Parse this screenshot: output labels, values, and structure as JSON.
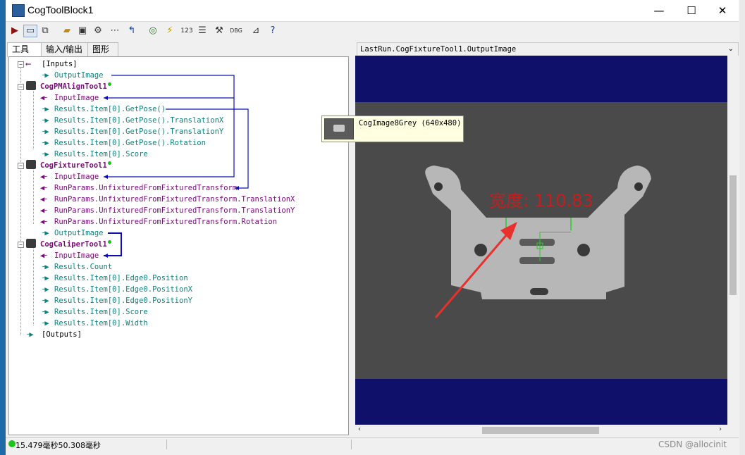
{
  "window": {
    "title": "CogToolBlock1",
    "minimize": "—",
    "maximize": "☐",
    "close": "✕"
  },
  "toolbar": {
    "items": [
      "run-icon",
      "display-icon",
      "view-icon",
      "open-icon",
      "save-icon",
      "settings-icon",
      "dots-icon",
      "reset-icon",
      "database-icon",
      "link-icon",
      "number-icon",
      "text-icon",
      "tools-icon",
      "debug-icon",
      "measure-icon",
      "help-icon"
    ]
  },
  "tabs": [
    "工具",
    "输入/输出",
    "图形"
  ],
  "tree": {
    "inputs_label": "[Inputs]",
    "inputs_output_image": "OutputImage",
    "pm_tool": "CogPMAlignTool1",
    "pm_input": "InputImage",
    "pm_pose": "Results.Item[0].GetPose()",
    "pm_tx": "Results.Item[0].GetPose().TranslationX",
    "pm_ty": "Results.Item[0].GetPose().TranslationY",
    "pm_rot": "Results.Item[0].GetPose().Rotation",
    "pm_score": "Results.Item[0].Score",
    "fix_tool": "CogFixtureTool1",
    "fix_input": "InputImage",
    "fix_transform": "RunParams.UnfixturedFromFixturedTransform",
    "fix_tx": "RunParams.UnfixturedFromFixturedTransform.TranslationX",
    "fix_ty": "RunParams.UnfixturedFromFixturedTransform.TranslationY",
    "fix_rot": "RunParams.UnfixturedFromFixturedTransform.Rotation",
    "fix_output": "OutputImage",
    "cal_tool": "CogCaliperTool1",
    "cal_input": "InputImage",
    "cal_count": "Results.Count",
    "cal_edge_pos": "Results.Item[0].Edge0.Position",
    "cal_edge_x": "Results.Item[0].Edge0.PositionX",
    "cal_edge_y": "Results.Item[0].Edge0.PositionY",
    "cal_score": "Results.Item[0].Score",
    "cal_width": "Results.Item[0].Width",
    "outputs_label": "[Outputs]"
  },
  "view": {
    "header": "LastRun.CogFixtureTool1.OutputImage",
    "tooltip": "CogImage8Grey (640x480)",
    "overlay_text": "宽度: 110.83"
  },
  "status": {
    "time_text": "15.479毫秒50.308毫秒"
  },
  "watermark": "CSDN @allocinit"
}
